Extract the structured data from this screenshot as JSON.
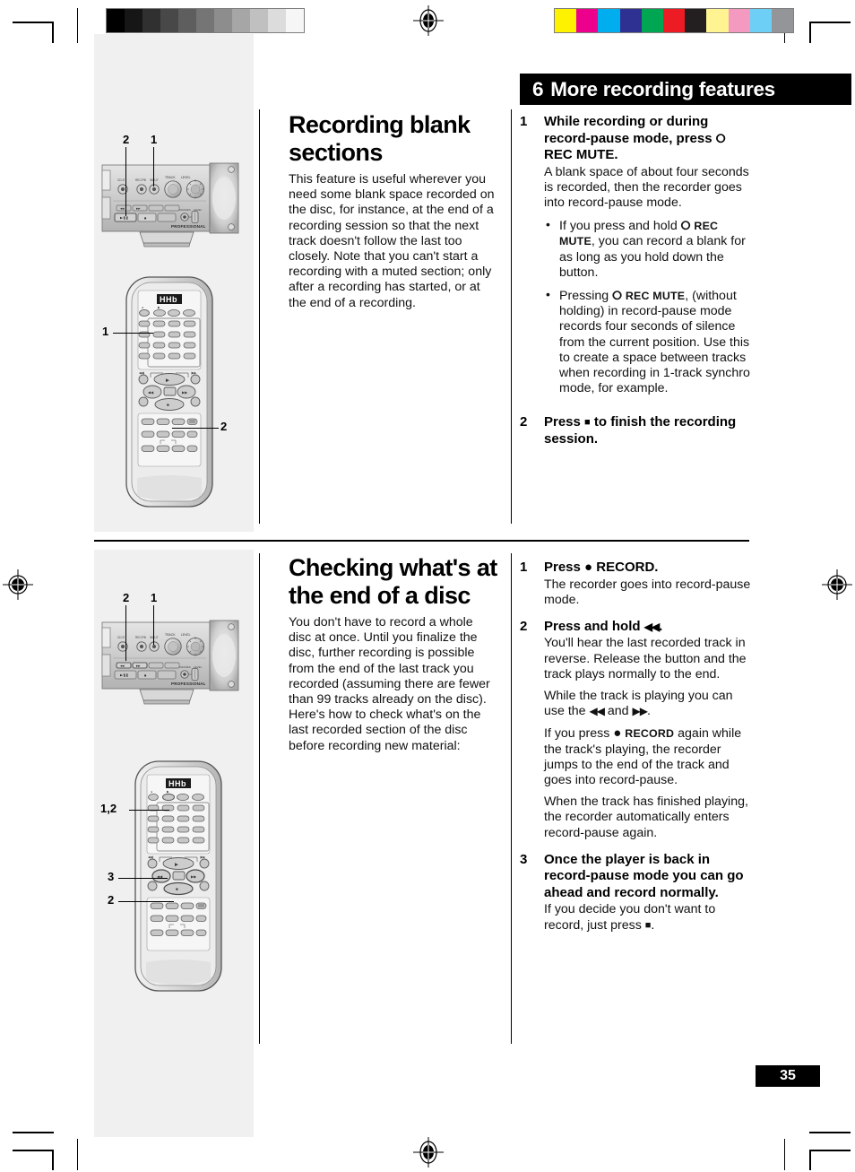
{
  "page": {
    "number": "35",
    "chapter_banner": {
      "number": "6",
      "title": "More recording features"
    }
  },
  "print_marks": {
    "grey_scale_steps": [
      "#000000",
      "#161616",
      "#303030",
      "#484848",
      "#5e5e5e",
      "#757575",
      "#8d8d8d",
      "#a6a6a6",
      "#c0c0c0",
      "#dcdcdc",
      "#f6f6f6"
    ],
    "color_swatches": [
      "#fff200",
      "#ec008c",
      "#00aeef",
      "#2e3192",
      "#00a651",
      "#ed1c24",
      "#231f20",
      "#fff392",
      "#f49ac1",
      "#6dcff6",
      "#939598"
    ],
    "registration_icon": "registration-crosshair"
  },
  "sections": [
    {
      "id": "recording-blank-sections",
      "heading": "Recording blank sections",
      "intro": "This feature is useful wherever you need some blank space recorded on the disc, for instance, at the end of a recording session so that the next track doesn't follow  the last too closely. Note that you can't start a recording with a muted section; only after a recording has started, or at the end of a recording.",
      "steps": [
        {
          "num": "1",
          "title_parts": [
            "While recording or during record-pause mode, press ",
            "O",
            " REC MUTE."
          ],
          "title_plain": "While recording or during record-pause mode, press O REC MUTE.",
          "text": "A blank space of about four seconds is recorded, then the recorder goes into record-pause mode.",
          "bullets": [
            "If you press and hold O REC MUTE, you can record a blank for as long as you hold down the button.",
            "Pressing O REC MUTE, (without holding) in record-pause mode records four seconds of silence from the current position. Use this to create a space between tracks when recording in 1-track synchro mode, for example."
          ]
        },
        {
          "num": "2",
          "title_plain": "Press ■ to finish the recording session.",
          "text": ""
        }
      ],
      "illustrations": {
        "deck": {
          "name": "front-panel-deck",
          "brand": "PROFESSIONAL",
          "callouts": [
            "2",
            "1"
          ]
        },
        "remote": {
          "name": "remote-control",
          "brand": "HHb",
          "callouts": [
            "1",
            "2"
          ]
        }
      }
    },
    {
      "id": "checking-end-of-disc",
      "heading": "Checking what's at the end of a disc",
      "intro": "You don't have to record a whole disc at once. Until you finalize the disc, further recording is possible from the end of the last track you recorded (assuming there are fewer than 99 tracks already on the disc). Here's how to check what's on the last recorded section of the disc before recording new material:",
      "steps": [
        {
          "num": "1",
          "title_plain": "Press ● RECORD.",
          "text": "The recorder goes into record-pause mode."
        },
        {
          "num": "2",
          "title_plain": "Press and hold ◀◀.",
          "paragraphs": [
            "You'll hear the last recorded track in reverse. Release the button and the track plays normally to the end.",
            "While the track is playing you can use the ◀◀ and ▶▶.",
            "If you press ● RECORD again while the track's playing, the recorder jumps to the end of the track and goes into record-pause.",
            "When the track has finished playing, the recorder automatically enters record-pause again."
          ]
        },
        {
          "num": "3",
          "title_plain": "Once the player is back in record-pause mode you can go ahead and record normally.",
          "text": "If you decide you don't want to record, just press ■."
        }
      ],
      "illustrations": {
        "deck": {
          "name": "front-panel-deck",
          "brand": "PROFESSIONAL",
          "callouts": [
            "2",
            "1"
          ]
        },
        "remote": {
          "name": "remote-control",
          "brand": "HHb",
          "callouts": [
            "1,2",
            "3",
            "2"
          ]
        }
      }
    }
  ],
  "labels": {
    "rec_mute_o": "O",
    "rec_mute": "REC MUTE",
    "rec_short": "REC",
    "mute_short": "MUTE",
    "record_word": "RECORD",
    "professional": "PROFESSIONAL",
    "hhb": "HHb",
    "pause_play": "▶/▐▐",
    "stop_glyph": "■",
    "record_glyph": "●",
    "rew_glyph": "◀◀",
    "ff_glyph": "▶▶"
  }
}
